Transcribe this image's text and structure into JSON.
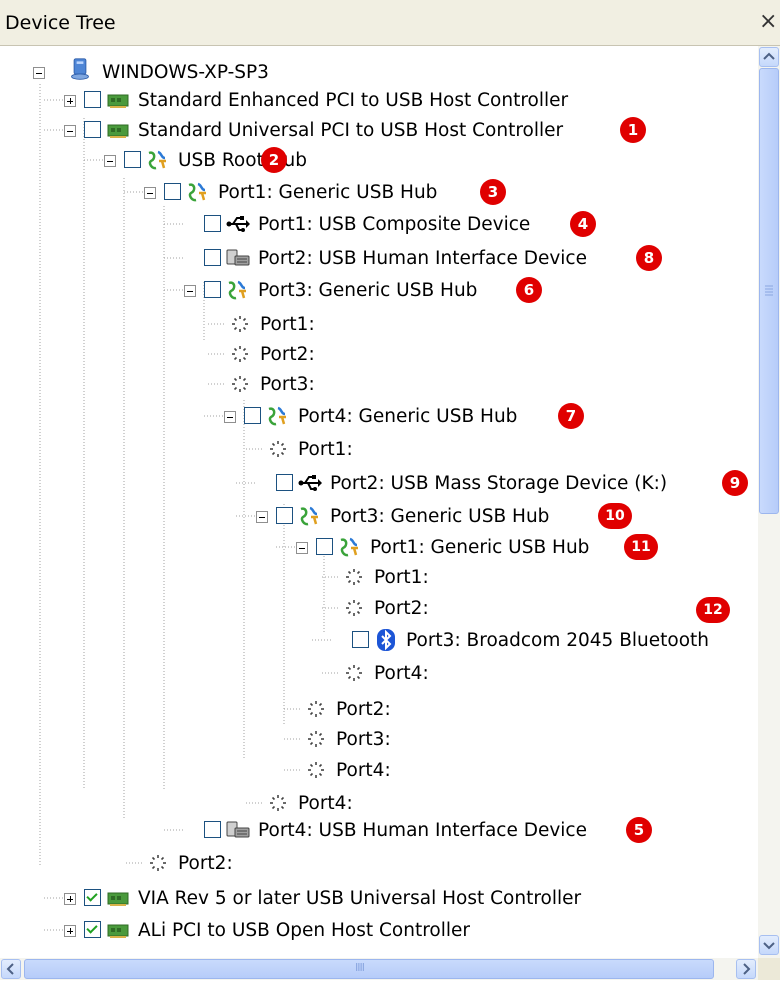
{
  "header": {
    "title": "Device Tree",
    "close_glyph": "×"
  },
  "tree": {
    "root": "WINDOWS-XP-SP3",
    "nodes": [
      {
        "label": "Standard Enhanced PCI to USB Host Controller",
        "icon": "pci-card-icon",
        "checked": false,
        "expander": "plus",
        "badge": ""
      },
      {
        "label": "Standard Universal PCI to USB Host Controller",
        "icon": "pci-card-icon",
        "checked": false,
        "expander": "minus",
        "badge": "1"
      },
      {
        "label": "USB Root Hub",
        "icon": "usb-hub-icon",
        "checked": false,
        "expander": "minus",
        "badge": "2"
      },
      {
        "label": "Port1: Generic USB Hub",
        "icon": "usb-hub-icon",
        "checked": false,
        "expander": "minus",
        "badge": "3"
      },
      {
        "label": "Port1: USB Composite Device",
        "icon": "usb-plug-icon",
        "checked": false,
        "expander": "none",
        "badge": "4"
      },
      {
        "label": "Port2: USB Human Interface Device",
        "icon": "hid-device-icon",
        "checked": false,
        "expander": "none",
        "badge": "8"
      },
      {
        "label": "Port3: Generic USB Hub",
        "icon": "usb-hub-icon",
        "checked": false,
        "expander": "minus",
        "badge": "6"
      },
      {
        "label": "Port1:",
        "icon": "empty-port-icon"
      },
      {
        "label": "Port2:",
        "icon": "empty-port-icon"
      },
      {
        "label": "Port3:",
        "icon": "empty-port-icon"
      },
      {
        "label": "Port4: Generic USB Hub",
        "icon": "usb-hub-icon",
        "checked": false,
        "expander": "minus",
        "badge": "7"
      },
      {
        "label": "Port1:",
        "icon": "empty-port-icon"
      },
      {
        "label": "Port2: USB Mass Storage Device (K:)",
        "icon": "usb-plug-icon",
        "checked": false,
        "expander": "none",
        "badge": "9"
      },
      {
        "label": "Port3: Generic USB Hub",
        "icon": "usb-hub-icon",
        "checked": false,
        "expander": "minus",
        "badge": "10"
      },
      {
        "label": "Port1: Generic USB Hub",
        "icon": "usb-hub-icon",
        "checked": false,
        "expander": "minus",
        "badge": "11"
      },
      {
        "label": "Port1:",
        "icon": "empty-port-icon"
      },
      {
        "label": "Port2:",
        "icon": "empty-port-icon"
      },
      {
        "label": "Port3: Broadcom 2045 Bluetooth",
        "icon": "bluetooth-icon",
        "checked": false,
        "expander": "none",
        "badge": "12"
      },
      {
        "label": "Port4:",
        "icon": "empty-port-icon"
      },
      {
        "label": "Port2:",
        "icon": "empty-port-icon"
      },
      {
        "label": "Port3:",
        "icon": "empty-port-icon"
      },
      {
        "label": "Port4:",
        "icon": "empty-port-icon"
      },
      {
        "label": "Port4:",
        "icon": "empty-port-icon"
      },
      {
        "label": "Port4: USB Human Interface Device",
        "icon": "hid-device-icon",
        "checked": false,
        "expander": "none",
        "badge": "5"
      },
      {
        "label": "Port2:",
        "icon": "empty-port-icon"
      },
      {
        "label": "VIA Rev 5 or later USB Universal Host Controller",
        "icon": "pci-card-icon",
        "checked": true,
        "expander": "plus",
        "badge": ""
      },
      {
        "label": "ALi PCI to USB Open Host Controller",
        "icon": "pci-card-icon",
        "checked": true,
        "expander": "plus",
        "badge": ""
      }
    ]
  },
  "scrollbars": {
    "hthumb_grip": "IIII"
  }
}
